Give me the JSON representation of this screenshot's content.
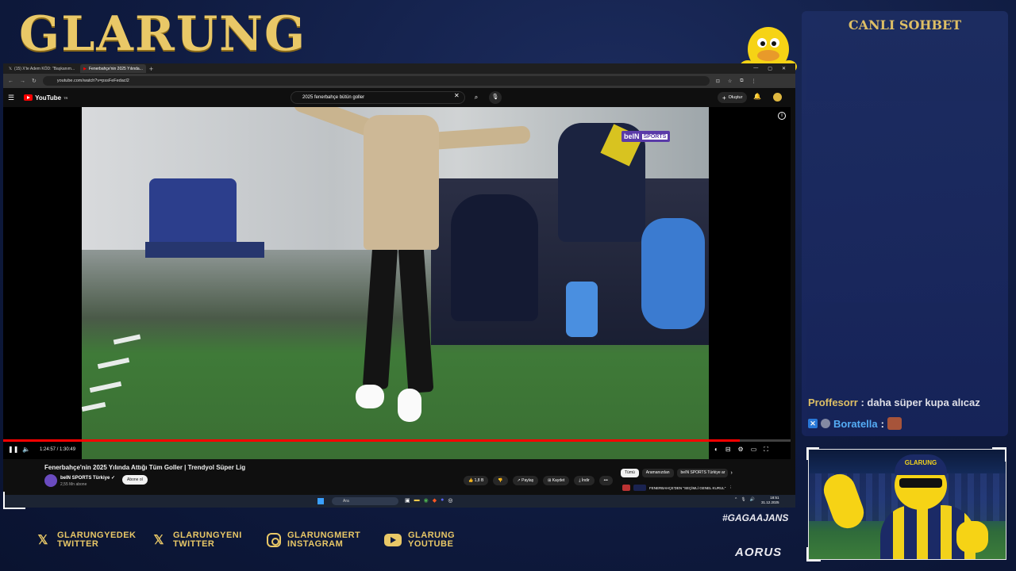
{
  "overlay": {
    "logo": "GLARUNG",
    "chat_title": "CANLI SOHBET",
    "hashtag": "#GAGAAJANS",
    "sponsor": "AORUS",
    "socials": [
      {
        "icon": "x-icon",
        "line1": "GLARUNGYEDEK",
        "line2": "TWITTER"
      },
      {
        "icon": "x-icon",
        "line1": "GLARUNGYENI",
        "line2": "TWITTER"
      },
      {
        "icon": "instagram-icon",
        "line1": "GLARUNGMERT",
        "line2": "INSTAGRAM"
      },
      {
        "icon": "youtube-icon",
        "line1": "GLARUNG",
        "line2": "YOUTUBE"
      }
    ],
    "webcam_cap_text": "GLARUNG"
  },
  "chat": {
    "messages": [
      {
        "user": "Proffesorr",
        "separator": " : ",
        "text": "daha süper kupa alıcaz"
      },
      {
        "user": "Boratella",
        "separator": " :",
        "text": ""
      }
    ]
  },
  "browser": {
    "tabs": [
      {
        "label": "(15) X'te Adem KÖD: \"Başkanım...",
        "active": false
      },
      {
        "label": "Fenerbahçe'nin 2025 Yılında...",
        "active": true
      }
    ],
    "url": "youtube.com/watch?v=pssFeFedacl2"
  },
  "youtube": {
    "logo_text": "YouTube",
    "logo_sup": "TR",
    "search_query": "2025 fenerbahçe bütün goller",
    "create_label": "Oluştur",
    "broadcaster_bug": "beIN",
    "broadcaster_bug_sport": "SPORTS",
    "player": {
      "time": "1:24:57 / 1:30:49",
      "progress_fraction": 0.935
    },
    "video_title": "Fenerbahçe'nin 2025 Yılında Attığı Tüm Goller | Trendyol Süper Lig",
    "channel_name": "beIN SPORTS Türkiye ✓",
    "channel_subs": "2,55 Mn abone",
    "subscribe_label": "Abone ol",
    "actions": [
      "👍 1,8 B",
      "👎",
      "↗ Paylaş",
      "⊞ Kaydet",
      "⤓ İndir",
      "•••"
    ],
    "chips": [
      {
        "label": "Tümü",
        "active": true
      },
      {
        "label": "Aramanızdan",
        "active": false
      },
      {
        "label": "beIN SPORTS Türkiye ar",
        "active": false
      }
    ],
    "rec_text": "FENERBAHÇE'DEN \"SEÇİMLİ GENEL KURUL\""
  },
  "taskbar": {
    "search_placeholder": "Ara",
    "clock_time": "18:51",
    "clock_date": "31.12.2025"
  }
}
